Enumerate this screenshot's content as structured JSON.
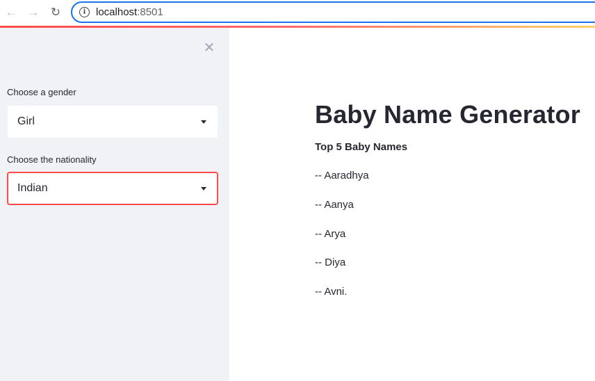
{
  "browser": {
    "url_host": "localhost",
    "url_port": ":8501",
    "icons": {
      "back": "arrow-left-icon",
      "forward": "arrow-right-icon",
      "reload": "reload-icon",
      "info": "info-icon"
    }
  },
  "sidebar": {
    "close_icon": "close-icon",
    "gender": {
      "label": "Choose a gender",
      "selected": "Girl"
    },
    "nationality": {
      "label": "Choose the nationality",
      "selected": "Indian"
    }
  },
  "main": {
    "title": "Baby Name Generator",
    "subheading": "Top 5 Baby Names",
    "names": [
      "-- Aaradhya",
      "-- Aanya",
      "-- Arya",
      "-- Diya",
      "-- Avni."
    ]
  },
  "colors": {
    "accent": "#ff4b4b",
    "sidebar_bg": "#f0f2f6",
    "text": "#262730",
    "address_border": "#1a73e8"
  }
}
